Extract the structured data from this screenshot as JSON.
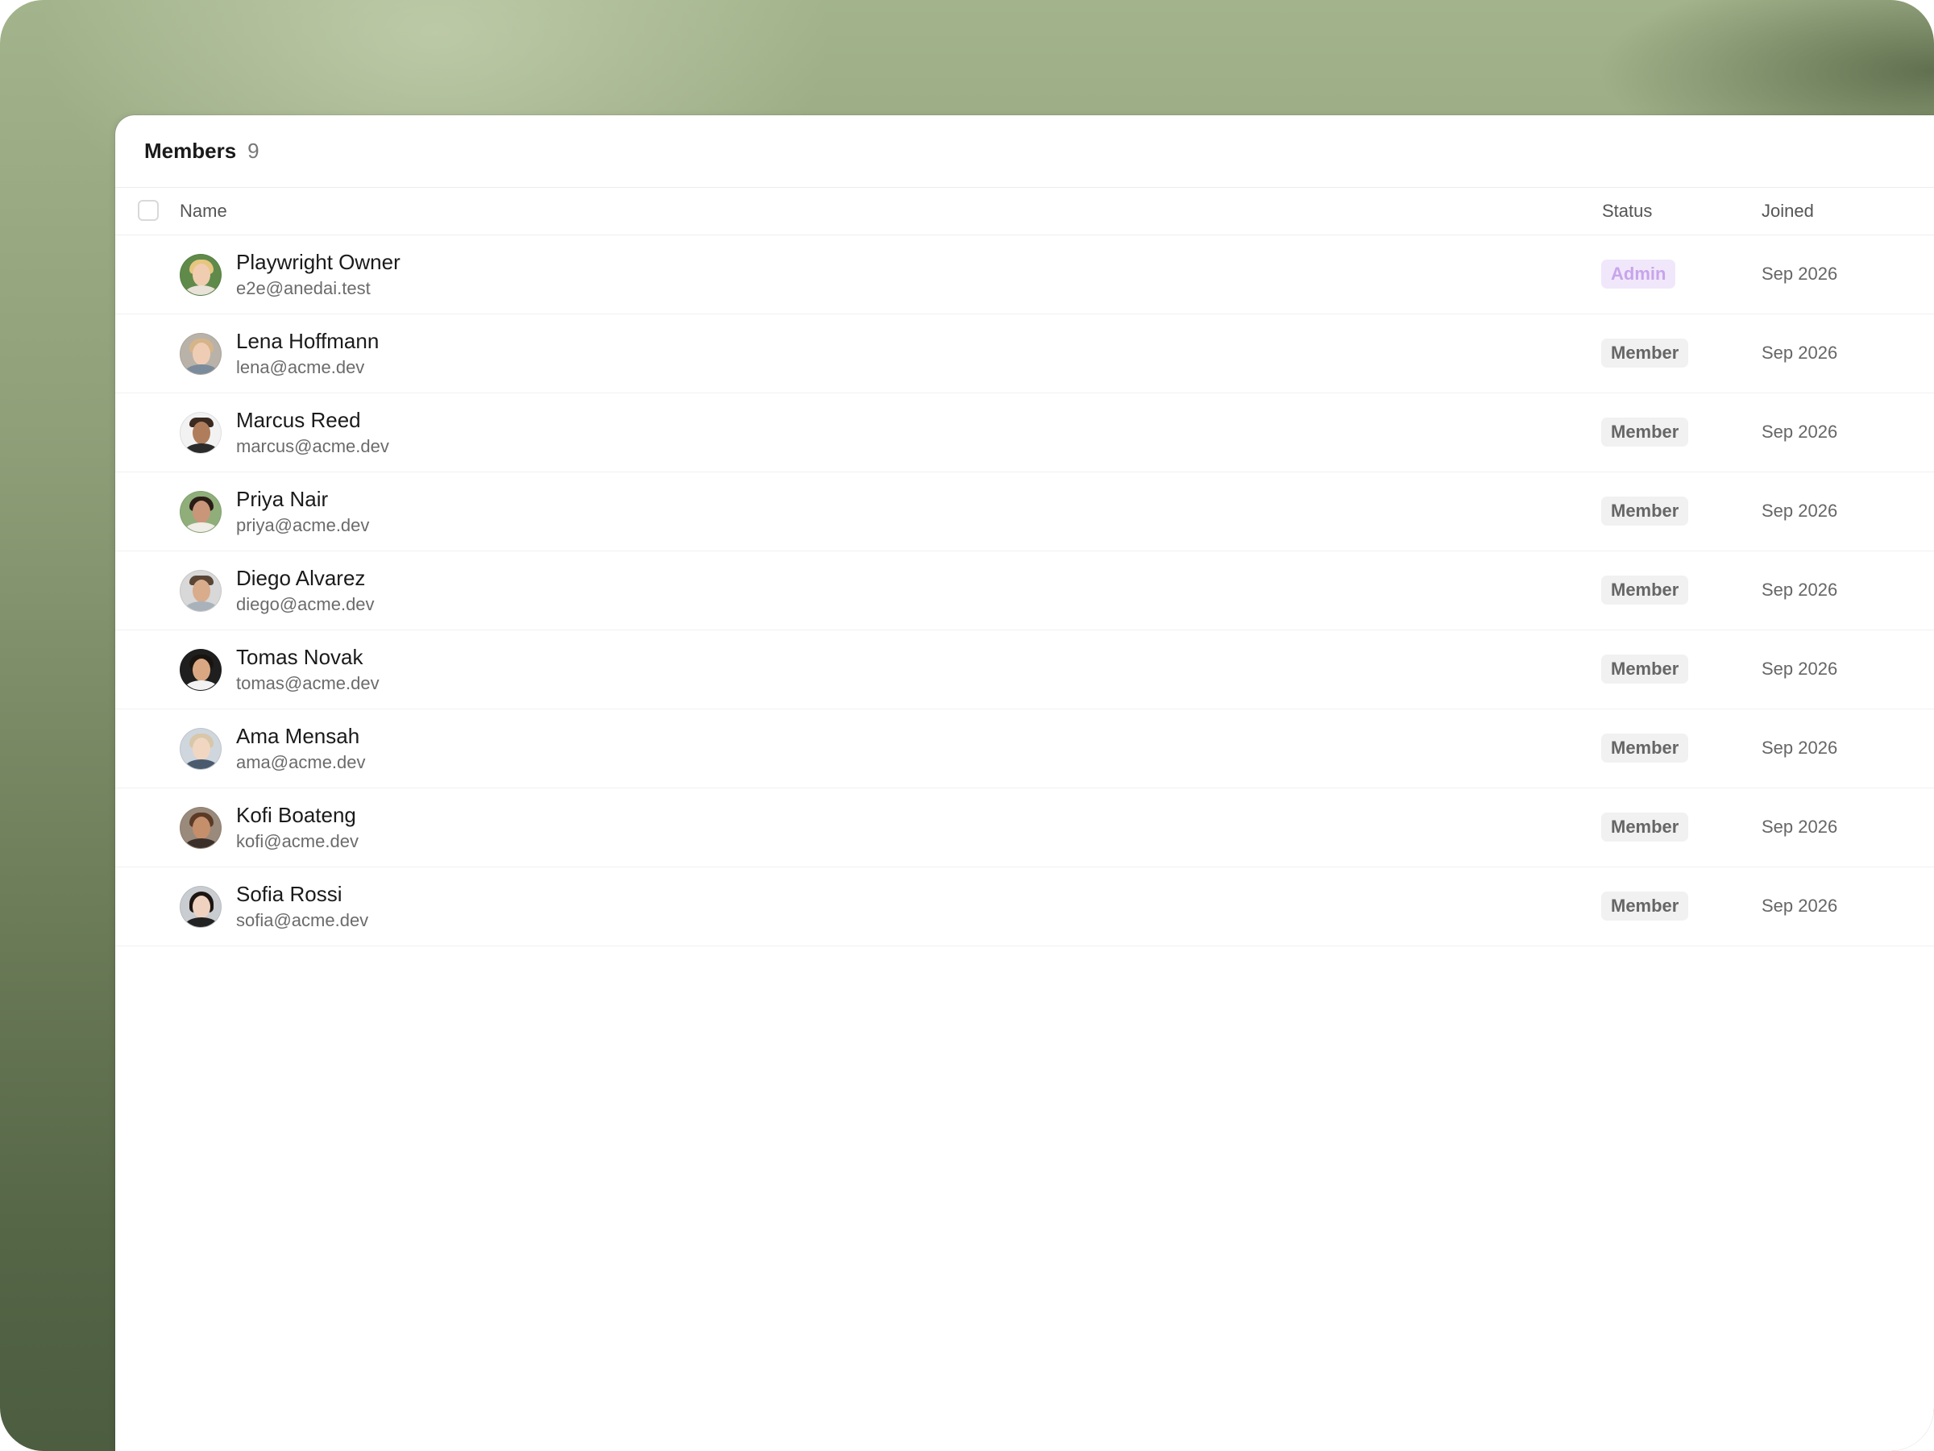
{
  "header": {
    "title": "Members",
    "count": "9"
  },
  "columns": {
    "name": "Name",
    "status": "Status",
    "joined": "Joined"
  },
  "colors": {
    "admin_badge_bg": "#f1e7fb",
    "admin_badge_text": "#c7a5ea",
    "member_badge_bg": "#f1f1f1"
  },
  "members": [
    {
      "name": "Playwright Owner",
      "email": "e2e@anedai.test",
      "status": "Admin",
      "joined": "Sep 2026"
    },
    {
      "name": "Lena Hoffmann",
      "email": "lena@acme.dev",
      "status": "Member",
      "joined": "Sep 2026"
    },
    {
      "name": "Marcus Reed",
      "email": "marcus@acme.dev",
      "status": "Member",
      "joined": "Sep 2026"
    },
    {
      "name": "Priya Nair",
      "email": "priya@acme.dev",
      "status": "Member",
      "joined": "Sep 2026"
    },
    {
      "name": "Diego Alvarez",
      "email": "diego@acme.dev",
      "status": "Member",
      "joined": "Sep 2026"
    },
    {
      "name": "Tomas Novak",
      "email": "tomas@acme.dev",
      "status": "Member",
      "joined": "Sep 2026"
    },
    {
      "name": "Ama Mensah",
      "email": "ama@acme.dev",
      "status": "Member",
      "joined": "Sep 2026"
    },
    {
      "name": "Kofi Boateng",
      "email": "kofi@acme.dev",
      "status": "Member",
      "joined": "Sep 2026"
    },
    {
      "name": "Sofia Rossi",
      "email": "sofia@acme.dev",
      "status": "Member",
      "joined": "Sep 2026"
    }
  ]
}
